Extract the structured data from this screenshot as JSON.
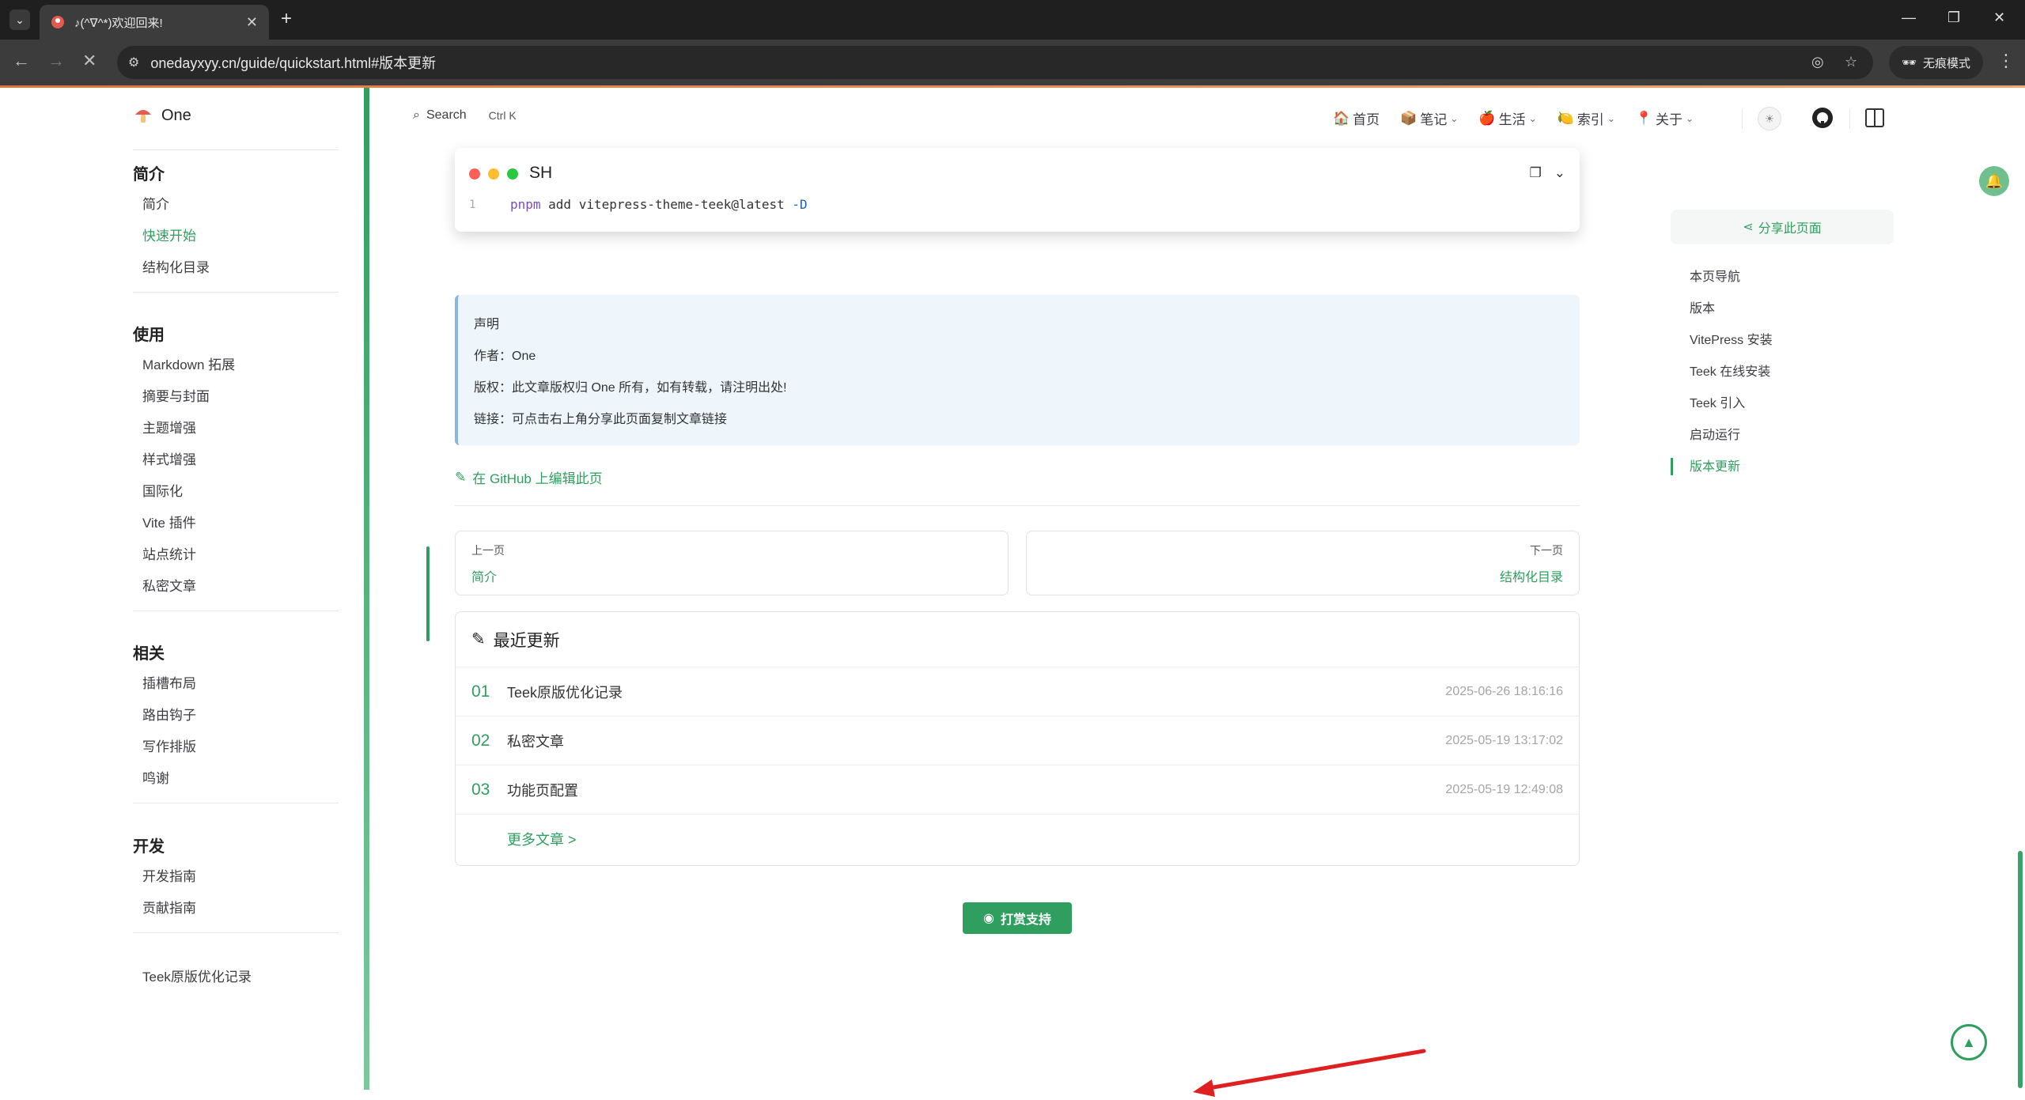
{
  "browser": {
    "tab_title": "♪(^∇^*)欢迎回来!",
    "new_tab": "+",
    "url": "onedayxyy.cn/guide/quickstart.html#版本更新",
    "incognito_label": "无痕模式",
    "window_controls": [
      "—",
      "❐",
      "✕"
    ]
  },
  "site": {
    "name": "One"
  },
  "sidebar": {
    "groups": [
      {
        "title": "简介",
        "items": [
          {
            "label": "简介",
            "active": false
          },
          {
            "label": "快速开始",
            "active": true
          },
          {
            "label": "结构化目录",
            "active": false
          }
        ]
      },
      {
        "title": "使用",
        "items": [
          {
            "label": "Markdown 拓展"
          },
          {
            "label": "摘要与封面"
          },
          {
            "label": "主题增强"
          },
          {
            "label": "样式增强"
          },
          {
            "label": "国际化"
          },
          {
            "label": "Vite 插件"
          },
          {
            "label": "站点统计"
          },
          {
            "label": "私密文章"
          }
        ]
      },
      {
        "title": "相关",
        "items": [
          {
            "label": "插槽布局"
          },
          {
            "label": "路由钩子"
          },
          {
            "label": "写作排版"
          },
          {
            "label": "鸣谢"
          }
        ]
      },
      {
        "title": "开发",
        "items": [
          {
            "label": "开发指南"
          },
          {
            "label": "贡献指南"
          }
        ]
      }
    ],
    "extra_item": "Teek原版优化记录"
  },
  "topnav": {
    "search_label": "Search",
    "search_kbd": "Ctrl K",
    "links": [
      {
        "label": "首页",
        "icon": "house-icon",
        "dropdown": false
      },
      {
        "label": "笔记",
        "icon": "book-icon",
        "dropdown": true
      },
      {
        "label": "生活",
        "icon": "leaf-icon",
        "dropdown": true
      },
      {
        "label": "索引",
        "icon": "tag-icon",
        "dropdown": true
      },
      {
        "label": "关于",
        "icon": "pin-icon",
        "dropdown": true
      }
    ]
  },
  "codeblock": {
    "lang": "SH",
    "line_number": "1",
    "cmd": "pnpm",
    "args": " add vitepress-theme-teek@latest ",
    "flag": "-D"
  },
  "notice": {
    "title": "声明",
    "author": "作者：One",
    "copyright": "版权：此文章版权归 One 所有，如有转载，请注明出处!",
    "link": "链接：可点击右上角分享此页面复制文章链接"
  },
  "edit_link": "在 GitHub 上编辑此页",
  "pager": {
    "prev_label": "上一页",
    "prev_title": "简介",
    "next_label": "下一页",
    "next_title": "结构化目录"
  },
  "recent": {
    "title": "最近更新",
    "items": [
      {
        "num": "01",
        "title": "Teek原版优化记录",
        "date": "2025-06-26 18:16:16"
      },
      {
        "num": "02",
        "title": "私密文章",
        "date": "2025-05-19 13:17:02"
      },
      {
        "num": "03",
        "title": "功能页配置",
        "date": "2025-05-19 12:49:08"
      }
    ],
    "more": "更多文章 >"
  },
  "donate_label": "打赏支持",
  "aside": {
    "share_label": "分享此页面",
    "toc": [
      {
        "label": "本页导航",
        "active": false
      },
      {
        "label": "版本",
        "active": false
      },
      {
        "label": "VitePress 安装",
        "active": false
      },
      {
        "label": "Teek 在线安装",
        "active": false
      },
      {
        "label": "Teek 引入",
        "active": false
      },
      {
        "label": "启动运行",
        "active": false
      },
      {
        "label": "版本更新",
        "active": true
      }
    ]
  },
  "colors": {
    "brand": "#2f9e5e",
    "arrow": "#e02020"
  }
}
